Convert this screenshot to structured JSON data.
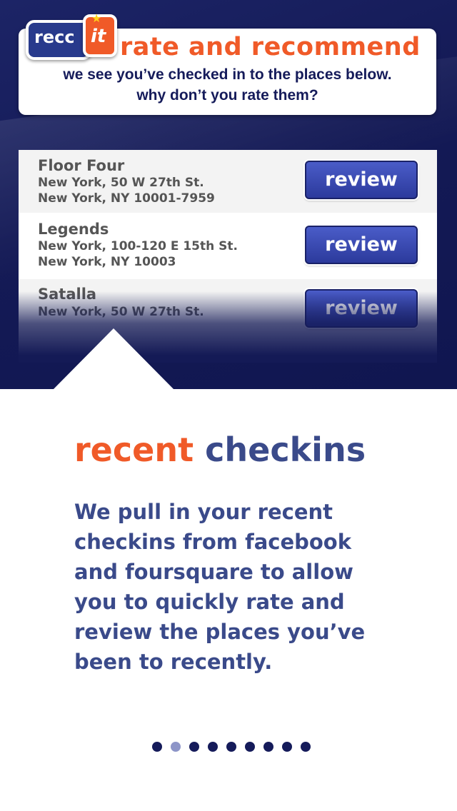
{
  "header": {
    "logo_left": "recc",
    "logo_right": "it",
    "title": "rate and recommend",
    "subtitle_line1": "we see you’ve checked in to the places below.",
    "subtitle_line2": "why don’t you rate them?"
  },
  "checkins": [
    {
      "name": "Floor Four",
      "address1": "New York, 50 W 27th St.",
      "address2": "New York, NY  10001-7959",
      "button": "review"
    },
    {
      "name": "Legends",
      "address1": "New York, 100-120 E 15th St.",
      "address2": "New York, NY  10003",
      "button": "review"
    },
    {
      "name": "Satalla",
      "address1": "New York, 50 W 27th St.",
      "address2": "",
      "button": "review"
    }
  ],
  "section": {
    "title_part1": "recent",
    "title_part2": "checkins",
    "description": "We pull in your recent checkins from facebook and foursquare to allow you to quickly rate and review the places you’ve been to recently."
  },
  "pagination": {
    "total": 9,
    "active_index": 1
  },
  "colors": {
    "accent_orange": "#f05a28",
    "navy": "#151b5a",
    "text_blue": "#3a4a8a",
    "button_blue": "#3a4ab4"
  },
  "icons": {
    "logo_star": "star-icon"
  }
}
